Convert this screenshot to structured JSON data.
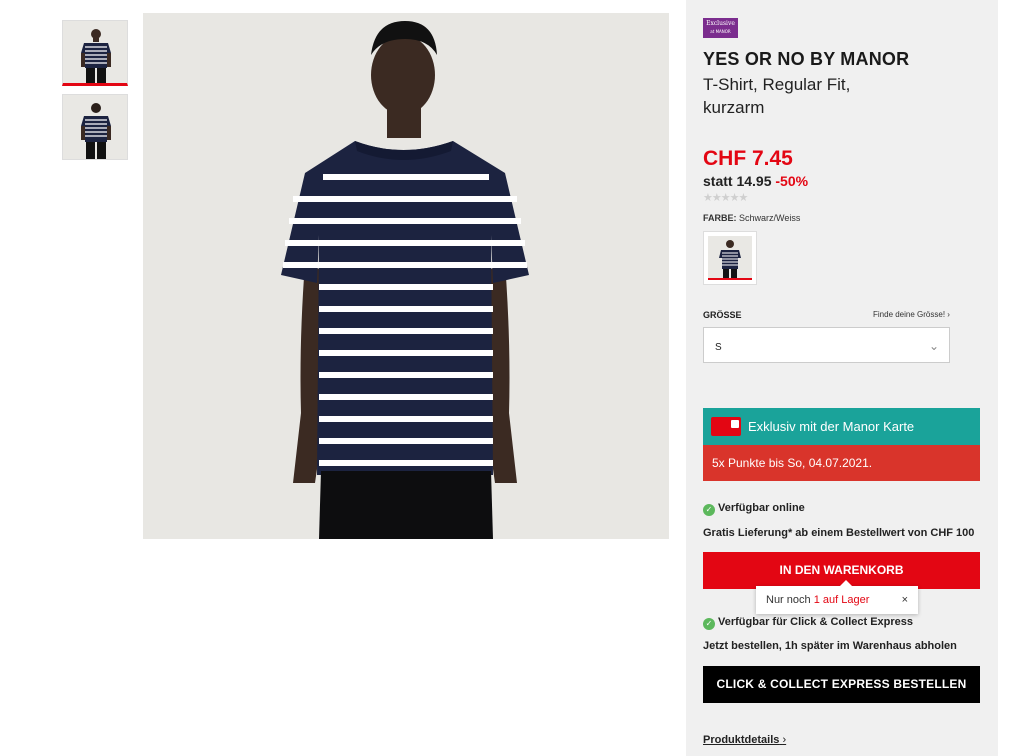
{
  "gallery": {
    "thumbnails": [
      "front view",
      "back view"
    ]
  },
  "product": {
    "logo": {
      "line1": "Exclusive",
      "line2": "at MANOR"
    },
    "brand": "YES OR NO BY MANOR",
    "name": "T-Shirt, Regular Fit, kurzarm",
    "price": "CHF 7.45",
    "old_price_label": "statt 14.95",
    "discount": "-50%",
    "rating_stars": "★★★★★",
    "color_label": "FARBE:",
    "color_value": "Schwarz/Weiss",
    "size_label": "GRÖSSE",
    "size_help": "Finde deine Grösse! ›",
    "size_selected": "S",
    "size_chevron": "⌄"
  },
  "promo": {
    "exclusive_text": "Exklusiv mit der Manor Karte",
    "points_text": "5x Punkte bis So, 04.07.2021."
  },
  "availability": {
    "online": "Verfügbar online",
    "delivery": "Gratis Lieferung* ab einem Bestellwert von CHF 100",
    "click_collect": "Verfügbar für Click & Collect Express",
    "click_collect_note": "Jetzt bestellen, 1h später im Warenhaus abholen"
  },
  "buttons": {
    "add_to_cart": "IN DEN WARENKORB",
    "click_collect": "CLICK & COLLECT EXPRESS BESTELLEN"
  },
  "tooltip": {
    "prefix": "Nur noch ",
    "stock": "1 auf Lager",
    "close": "×"
  },
  "links": {
    "product_details": "Produktdetails",
    "product_details_chevron": "›"
  },
  "colors": {
    "brand_red": "#e30613",
    "teal": "#1aa39a",
    "promo_red": "#d9342b",
    "navy": "#1c2340"
  }
}
